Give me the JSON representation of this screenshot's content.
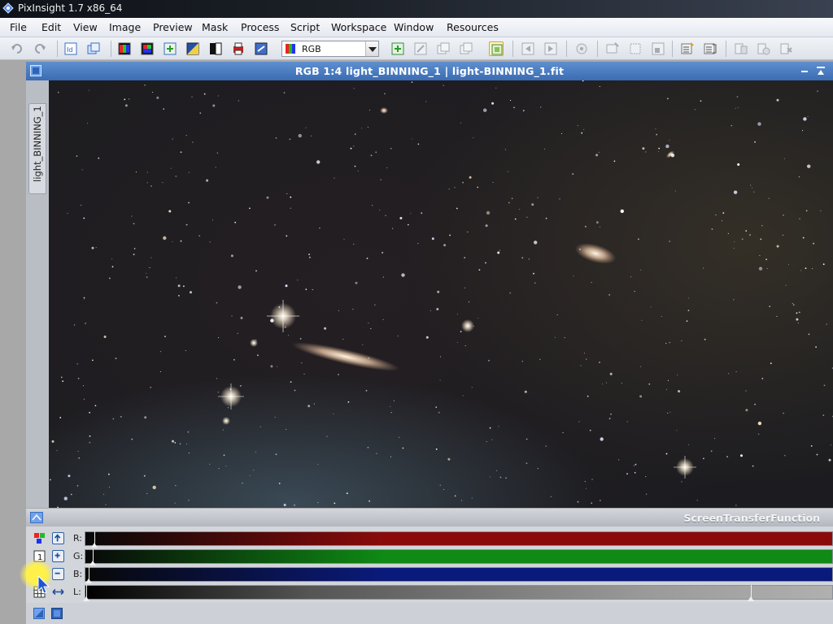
{
  "app": {
    "title": "PixInsight 1.7 x86_64"
  },
  "menubar": {
    "items": [
      "File",
      "Edit",
      "View",
      "Image",
      "Preview",
      "Mask",
      "Process",
      "Script",
      "Workspace",
      "Window",
      "Resources"
    ]
  },
  "toolbar": {
    "combo_value": "RGB",
    "icons": [
      "undo-icon",
      "redo-icon",
      "identifier-icon",
      "clone-view-icon",
      "rgb-channels-icon",
      "color-channels-icon",
      "new-image-icon",
      "invert-icon",
      "auto-stf-icon",
      "print-icon",
      "refresh-icon",
      "new-preview-icon",
      "edit-preview-icon",
      "copy-preview-icon",
      "delete-preview-icon",
      "mask-enable-icon",
      "previous-icon",
      "next-icon",
      "lock-icon",
      "readout-icon",
      "zoom-fit-icon",
      "zoom-one-icon",
      "zoom-in-icon",
      "process-icon",
      "script-icon",
      "explorer-icon",
      "history-icon",
      "format-icon"
    ]
  },
  "image_window": {
    "title": "RGB 1:4 light_BINNING_1 | light-BINNING_1.fit",
    "vertical_tab": "light_BINNING_1"
  },
  "stf": {
    "title": "ScreenTransferFunction",
    "channels": [
      {
        "label": "R:",
        "color": "#8a0a0a",
        "shadow_marker": 0.012
      },
      {
        "label": "G:",
        "color": "#0f8a14",
        "shadow_marker": 0.01
      },
      {
        "label": "B:",
        "color": "#0a1a7a",
        "shadow_marker": 0.005
      },
      {
        "label": "L:",
        "color": "#9a9a9a",
        "shadow_marker": 0.0,
        "midtone_marker": 0.89
      }
    ]
  }
}
